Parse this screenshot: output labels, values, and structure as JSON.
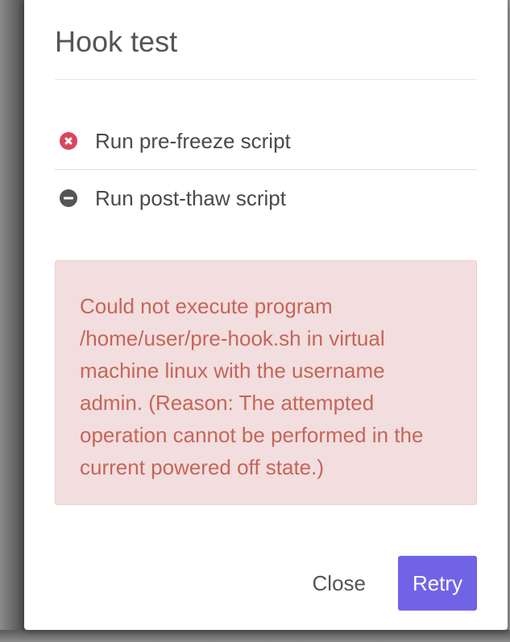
{
  "dialog": {
    "title": "Hook test",
    "steps": [
      {
        "label": "Run pre-freeze script",
        "status": "error",
        "icon": "error-circle-icon"
      },
      {
        "label": "Run post-thaw script",
        "status": "skipped",
        "icon": "minus-circle-icon"
      }
    ],
    "error_message": "Could not execute program /home/user/pre-hook.sh in virtual machine linux with the username admin. (Reason: The attempted operation cannot be performed in the current powered off state.)",
    "buttons": {
      "close_label": "Close",
      "retry_label": "Retry"
    }
  },
  "colors": {
    "accent": "#7163e6",
    "error_icon": "#d9475c",
    "alert_background": "#f2dede",
    "alert_text": "#c6655a"
  }
}
